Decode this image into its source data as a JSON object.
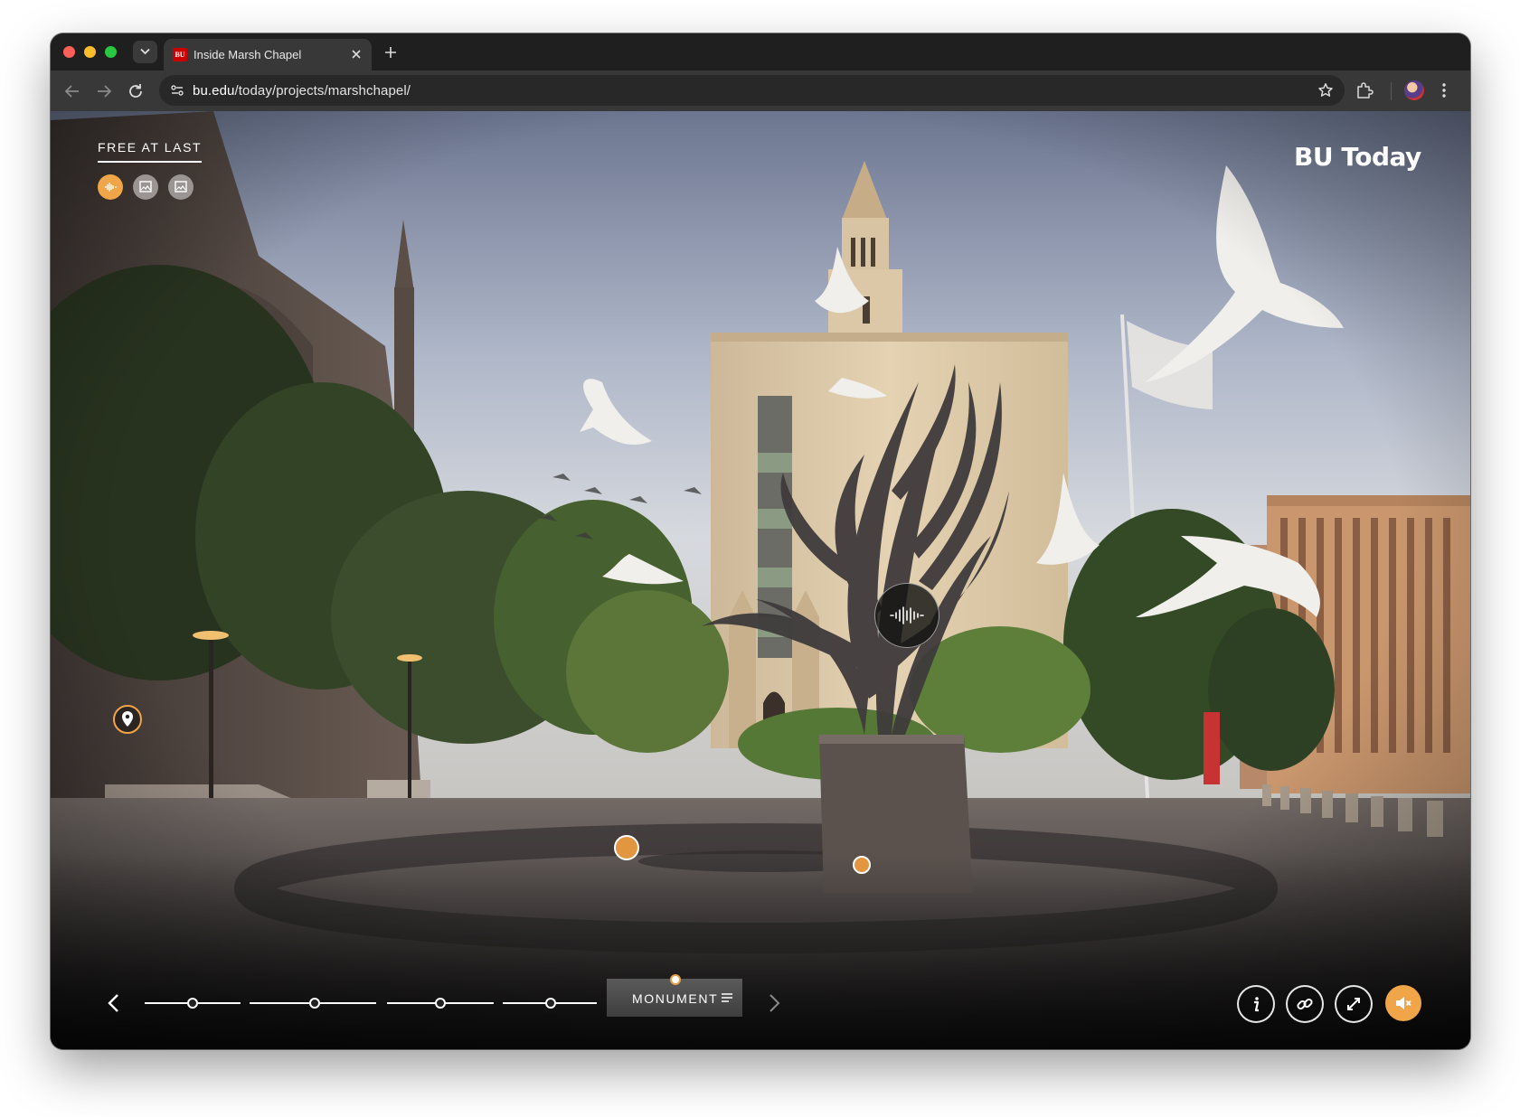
{
  "browser": {
    "tab_title": "Inside Marsh Chapel",
    "favicon_text": "BU",
    "url_host": "bu.edu",
    "url_path": "/today/projects/marshchapel/"
  },
  "page": {
    "section_title": "FREE AT LAST",
    "brand": "BU Today",
    "media_buttons": [
      "audio-icon",
      "image-icon",
      "image-icon"
    ],
    "current_chapter": "MONUMENT",
    "timeline_segments": 4,
    "controls": [
      "info-icon",
      "link-icon",
      "fullscreen-icon",
      "mute-icon"
    ],
    "accent_color": "#f0a548"
  }
}
